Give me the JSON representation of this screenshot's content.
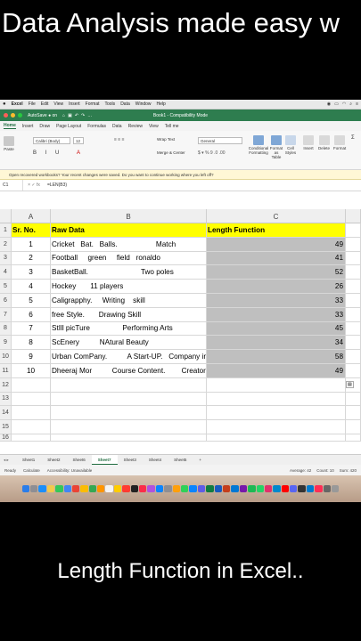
{
  "headline": "Data Analysis made easy w",
  "caption": "Length Function in Excel..",
  "menubar": {
    "apple": "",
    "app": "Excel",
    "items": [
      "File",
      "Edit",
      "View",
      "Insert",
      "Format",
      "Tools",
      "Data",
      "Window",
      "Help"
    ]
  },
  "titlebar": {
    "autosave": "AutoSave ● on",
    "title": "Book1 - Compatibility Mode"
  },
  "ribbon_tabs": [
    "Home",
    "Insert",
    "Draw",
    "Page Layout",
    "Formulas",
    "Data",
    "Review",
    "View",
    "Tell me"
  ],
  "ribbon": {
    "paste": "Paste",
    "font": "Calibri (Body)",
    "font_size": "12",
    "wrap": "Wrap Text",
    "merge": "Merge & Center",
    "number_format": "General",
    "cond_format": "Conditional Formatting",
    "format_table": "Format as Table",
    "cell_styles": "Cell Styles",
    "insert": "Insert",
    "delete": "Delete",
    "format": "Format"
  },
  "notice": "Open recovered workbooks?  Your recent changes were saved. Do you want to continue working where you left off?",
  "formula_bar": {
    "cell": "C1",
    "formula": "=LEN(B3)"
  },
  "columns": [
    "A",
    "B",
    "C"
  ],
  "header_row": {
    "num": "1",
    "a": "Sr. No.",
    "b": "Raw Data",
    "c": "Length Function"
  },
  "rows": [
    {
      "num": "2",
      "a": "1",
      "b": "Cricket   Bat.   Balls.                   Match",
      "c": "49"
    },
    {
      "num": "3",
      "a": "2",
      "b": "Football     green     field   ronaldo",
      "c": "41"
    },
    {
      "num": "4",
      "a": "3",
      "b": "BasketBall.                          Two poles",
      "c": "52"
    },
    {
      "num": "5",
      "a": "4",
      "b": "Hockey       11 players",
      "c": "26"
    },
    {
      "num": "6",
      "a": "5",
      "b": "Caligrapphy.     Writing    skill",
      "c": "33"
    },
    {
      "num": "7",
      "a": "6",
      "b": "free Style.       Drawing Skill",
      "c": "33"
    },
    {
      "num": "8",
      "a": "7",
      "b": "StIll picTure                Performing Arts",
      "c": "45"
    },
    {
      "num": "9",
      "a": "8",
      "b": "ScEnery          NAtural Beauty",
      "c": "34"
    },
    {
      "num": "10",
      "a": "9",
      "b": "Urban ComPany.          A Start-UP.   Company in     india",
      "c": "58"
    },
    {
      "num": "11",
      "a": "10",
      "b": "Dheeraj Mor          Course Content.        Creator",
      "c": "49"
    }
  ],
  "empty_rows": [
    "12",
    "13",
    "14",
    "15",
    "16"
  ],
  "sheet_tabs": [
    "Sheet1",
    "Sheet2",
    "Sheet6",
    "Sheet7",
    "Sheet3",
    "Sheet4",
    "Sheet5",
    "+"
  ],
  "active_sheet": "Sheet7",
  "status": {
    "ready": "Ready",
    "calc": "Calculate",
    "access": "Accessibility: Unavailable",
    "average": "Average: 42",
    "count": "Count: 10",
    "sum": "Sum: 420"
  },
  "colors": {
    "excel_green": "#2e7d4f",
    "header_yellow": "#ffff00",
    "result_gray": "#bfbfbf"
  }
}
